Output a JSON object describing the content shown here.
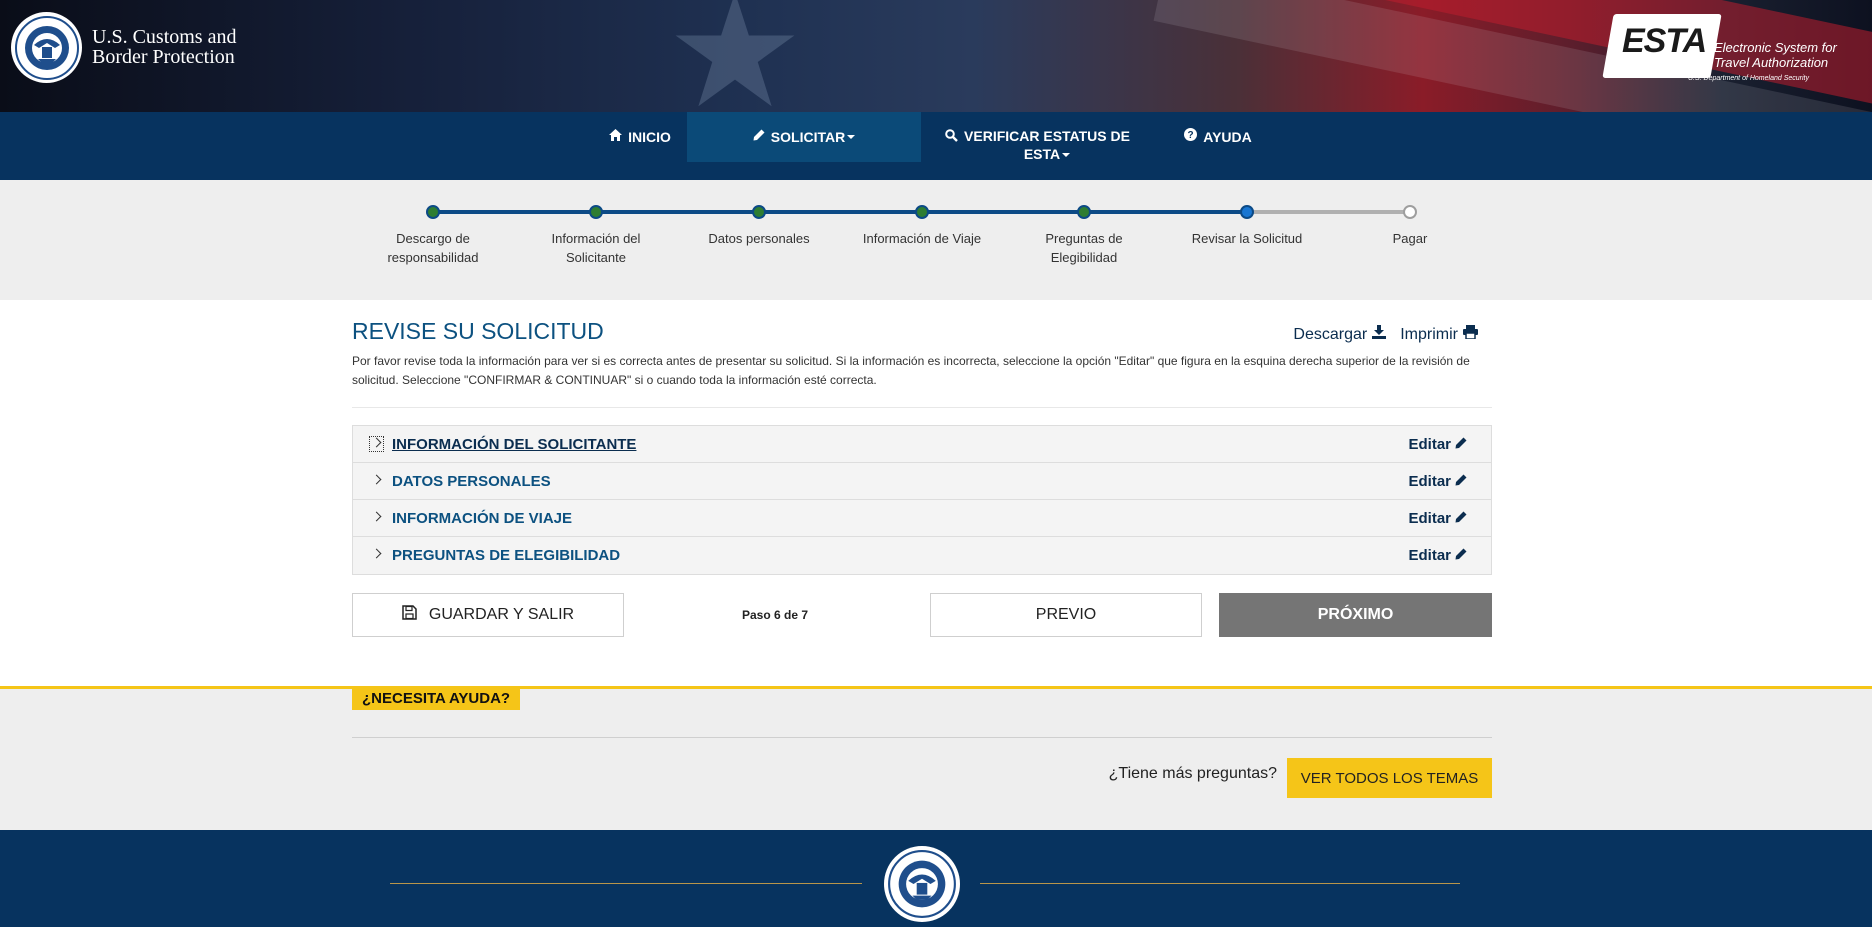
{
  "header": {
    "agency_line1": "U.S. Customs and",
    "agency_line2": "Border Protection",
    "esta_logo_word": "ESTA",
    "esta_tagline_line1": "Electronic System for",
    "esta_tagline_line2": "Travel Authorization",
    "esta_subline": "U.S. Department of Homeland Security"
  },
  "nav": {
    "items": [
      {
        "label": "INICIO",
        "icon": "home-icon"
      },
      {
        "label": "SOLICITAR",
        "icon": "pencil-icon",
        "active": true
      },
      {
        "label_line1": "VERIFICAR ESTATUS DE",
        "label_line2": "ESTA",
        "icon": "search-icon"
      },
      {
        "label": "AYUDA",
        "icon": "question-circle-icon"
      }
    ]
  },
  "stepper": {
    "steps": [
      {
        "line1": "Descargo de",
        "line2": "responsabilidad",
        "status": "done"
      },
      {
        "line1": "Información del",
        "line2": "Solicitante",
        "status": "done"
      },
      {
        "line1": "Datos personales",
        "line2": "",
        "status": "done"
      },
      {
        "line1": "Información de Viaje",
        "line2": "",
        "status": "done"
      },
      {
        "line1": "Preguntas de",
        "line2": "Elegibilidad",
        "status": "done"
      },
      {
        "line1": "Revisar la Solicitud",
        "line2": "",
        "status": "current"
      },
      {
        "line1": "Pagar",
        "line2": "",
        "status": "todo"
      }
    ],
    "colors": {
      "done": "#2e7d32",
      "current": "#1976d2",
      "track": "#0c4a86",
      "todo_track": "#b0b0b0"
    }
  },
  "main": {
    "title": "REVISE SU SOLICITUD",
    "download_label": "Descargar",
    "print_label": "Imprimir",
    "description": "Por favor revise toda la información para ver si es correcta antes de presentar su solicitud. Si la información es incorrecta, seleccione la opción \"Editar\" que figura en la esquina derecha superior de la revisión de solicitud. Seleccione \"CONFIRMAR & CONTINUAR\" si o cuando toda la información esté correcta.",
    "sections": [
      {
        "title": "INFORMACIÓN DEL SOLICITANTE",
        "edit": "Editar"
      },
      {
        "title": "DATOS PERSONALES",
        "edit": "Editar"
      },
      {
        "title": "INFORMACIÓN DE VIAJE",
        "edit": "Editar"
      },
      {
        "title": "PREGUNTAS DE ELEGIBILIDAD",
        "edit": "Editar"
      }
    ],
    "save_exit_label": "GUARDAR Y SALIR",
    "step_count": "Paso 6 de 7",
    "prev_label": "PREVIO",
    "next_label": "PRÓXIMO"
  },
  "help": {
    "badge": "¿NECESITA AYUDA?",
    "more_questions": "¿Tiene más preguntas?",
    "topics_button": "VER TODOS LOS TEMAS",
    "accent_color": "#f5c518"
  },
  "colors": {
    "navy": "#07335f",
    "nav_active": "#0b4a78",
    "title_blue": "#0c5180"
  }
}
